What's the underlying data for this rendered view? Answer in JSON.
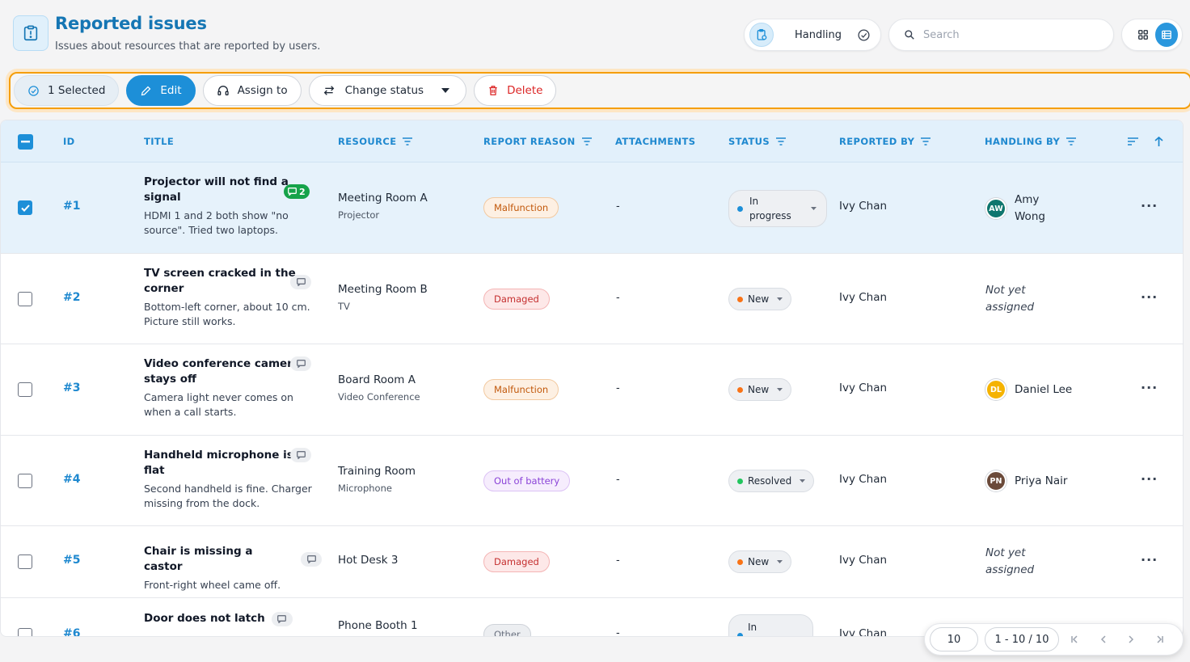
{
  "header": {
    "title": "Reported issues",
    "subtitle": "Issues about resources that are reported by users.",
    "handling_label": "Handling",
    "search_placeholder": "Search"
  },
  "toolbar": {
    "selected_label": "1 Selected",
    "edit_label": "Edit",
    "assign_label": "Assign to",
    "change_status_label": "Change status",
    "delete_label": "Delete"
  },
  "table": {
    "columns": {
      "id": "ID",
      "title": "TITLE",
      "resource": "RESOURCE",
      "reason": "REPORT REASON",
      "attachments": "ATTACHMENTS",
      "status": "STATUS",
      "reported_by": "REPORTED BY",
      "handling_by": "HANDLING BY"
    },
    "rows": [
      {
        "id": "#1",
        "title_l1": "Projector will not find a",
        "title_l2": "signal",
        "desc_l1": "HDMI 1 and 2 both show \"no",
        "desc_l2": "source\". Tried two laptops.",
        "messages": "2",
        "resource": "Meeting Room A",
        "resource_type": "Projector",
        "reason": "Malfunction",
        "attachments": "-",
        "status_l1": "In",
        "status_l2": "progress",
        "reported_by": "Ivy Chan",
        "handler_initials": "AW",
        "handler_l1": "Amy",
        "handler_l2": "Wong"
      },
      {
        "id": "#2",
        "title_l1": "TV screen cracked in the",
        "title_l2": "corner",
        "desc_l1": "Bottom-left corner, about 10 cm.",
        "desc_l2": "Picture still works.",
        "resource": "Meeting Room B",
        "resource_type": "TV",
        "reason": "Damaged",
        "attachments": "-",
        "status": "New",
        "reported_by": "Ivy Chan",
        "unassigned_l1": "Not yet",
        "unassigned_l2": "assigned"
      },
      {
        "id": "#3",
        "title_l1": "Video conference camera",
        "title_l2": "stays off",
        "desc_l1": "Camera light never comes on",
        "desc_l2": "when a call starts.",
        "resource": "Board Room A",
        "resource_type": "Video Conference",
        "reason": "Malfunction",
        "attachments": "-",
        "status": "New",
        "reported_by": "Ivy Chan",
        "handler_initials": "DL",
        "handler": "Daniel Lee"
      },
      {
        "id": "#4",
        "title_l1": "Handheld microphone is",
        "title_l2": "flat",
        "desc_l1": "Second handheld is fine. Charger",
        "desc_l2": "missing from the dock.",
        "resource": "Training Room",
        "resource_type": "Microphone",
        "reason": "Out of battery",
        "attachments": "-",
        "status": "Resolved",
        "reported_by": "Ivy Chan",
        "handler_initials": "PN",
        "handler": "Priya Nair"
      },
      {
        "id": "#5",
        "title": "Chair is missing a castor",
        "desc": "Front-right wheel came off.",
        "resource": "Hot Desk 3",
        "reason": "Damaged",
        "attachments": "-",
        "status": "New",
        "reported_by": "Ivy Chan",
        "unassigned_l1": "Not yet",
        "unassigned_l2": "assigned"
      },
      {
        "id": "#6",
        "title": "Door does not latch",
        "resource": "Phone Booth 1",
        "reason": "Other",
        "attachments": "-",
        "status_l1": "In",
        "reported_by": "Ivy Chan"
      }
    ]
  },
  "pagination": {
    "page_size": "10",
    "range": "1 - 10 / 10"
  },
  "colors": {
    "accent": "#1d8fd8",
    "selection_outline": "#f59e0b",
    "status_in_progress": "#1d8fd8",
    "status_new": "#f97316",
    "status_resolved": "#22c55e",
    "avatar_aw": "#0f766e",
    "avatar_dl": "#f5b301",
    "avatar_pn": "#6b4a3a"
  },
  "icons": [
    "report-issue-icon",
    "handling-clipboard-icon",
    "check-circle-icon",
    "search-icon",
    "grid-view-icon",
    "list-view-icon",
    "check-circle-icon",
    "pencil-icon",
    "headset-icon",
    "swap-arrows-icon",
    "caret-down-icon",
    "trash-icon",
    "filter-icon",
    "sort-lines-icon",
    "arrow-up-icon",
    "comment-icon",
    "more-dots-icon",
    "first-page-icon",
    "prev-page-icon",
    "next-page-icon",
    "last-page-icon"
  ]
}
